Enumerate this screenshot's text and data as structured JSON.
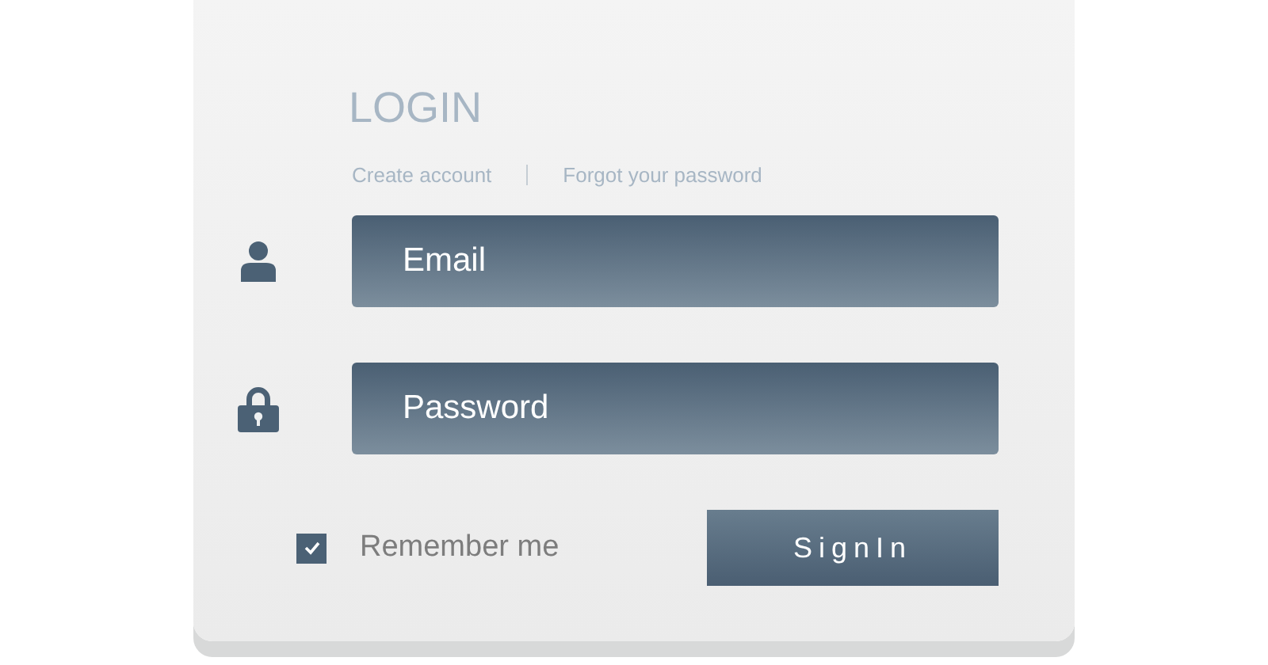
{
  "title": "LOGIN",
  "links": [
    {
      "label": "Create account"
    },
    {
      "label": "Forgot your password"
    }
  ],
  "fields": [
    {
      "kind": "email",
      "placeholder": "Email"
    },
    {
      "kind": "password",
      "placeholder": "Password"
    }
  ],
  "remember": {
    "label": "Remember me",
    "checked": true
  },
  "submit": {
    "label": "SignIn"
  }
}
